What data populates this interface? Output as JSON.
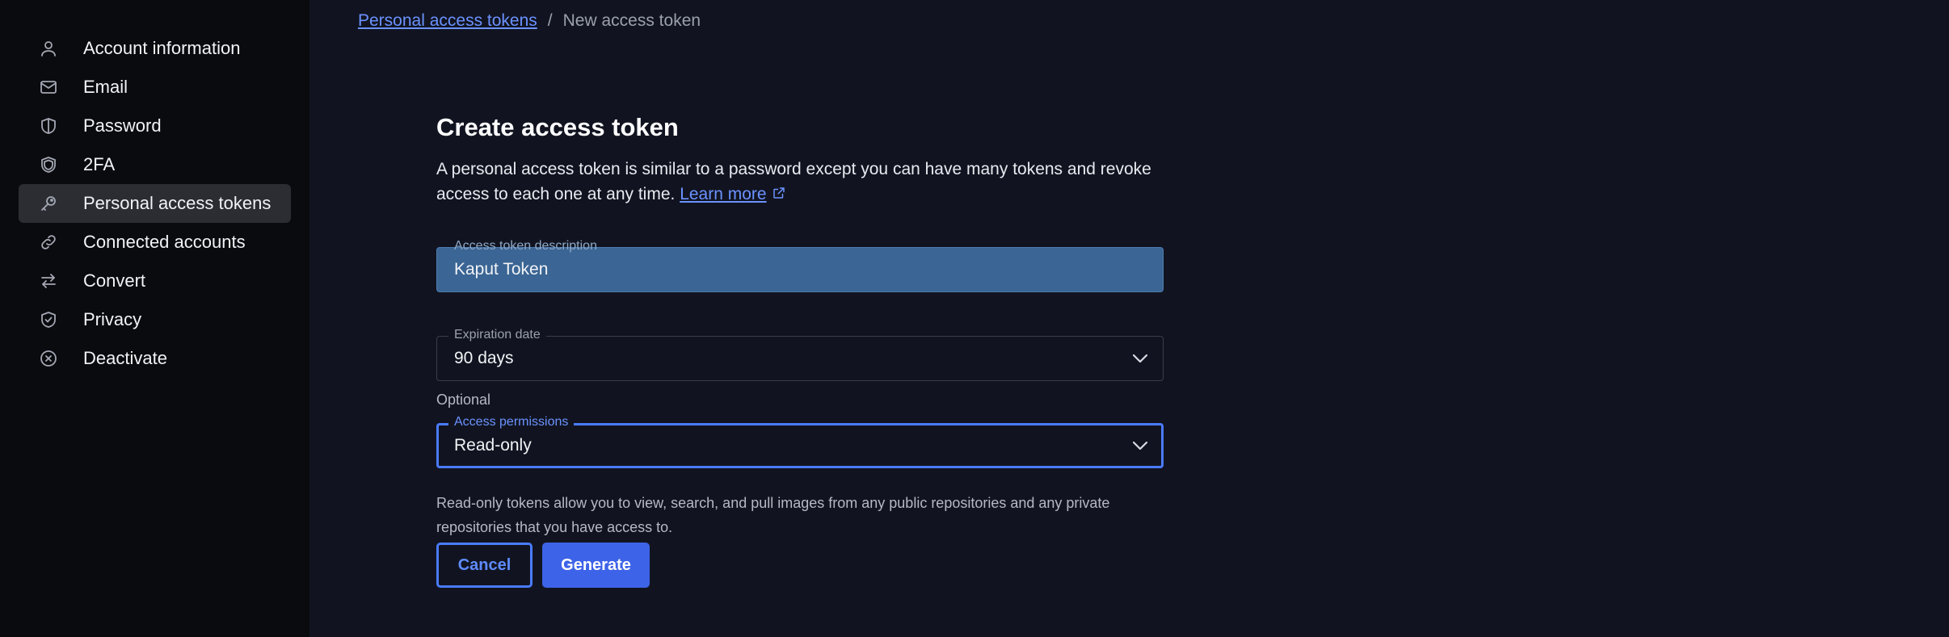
{
  "sidebar": {
    "items": [
      {
        "label": "Account information",
        "icon": "user-icon"
      },
      {
        "label": "Email",
        "icon": "mail-icon"
      },
      {
        "label": "Password",
        "icon": "shield-half-icon"
      },
      {
        "label": "2FA",
        "icon": "shield-double-icon"
      },
      {
        "label": "Personal access tokens",
        "icon": "key-icon",
        "active": true
      },
      {
        "label": "Connected accounts",
        "icon": "link-icon"
      },
      {
        "label": "Convert",
        "icon": "swap-arrows-icon"
      },
      {
        "label": "Privacy",
        "icon": "shield-check-icon"
      },
      {
        "label": "Deactivate",
        "icon": "circle-x-icon"
      }
    ]
  },
  "breadcrumb": {
    "parent": "Personal access tokens",
    "separator": "/",
    "current": "New access token"
  },
  "form": {
    "title": "Create access token",
    "description": "A personal access token is similar to a password except you can have many tokens and revoke access to each one at any time.",
    "learn_more": "Learn more",
    "description_field": {
      "label": "Access token description",
      "value": "Kaput Token"
    },
    "expiration": {
      "label": "Expiration date",
      "value": "90 days"
    },
    "optional_label": "Optional",
    "permissions": {
      "label": "Access permissions",
      "value": "Read-only"
    },
    "help_text": "Read-only tokens allow you to view, search, and pull images from any public repositories and any private repositories that you have access to.",
    "cancel_label": "Cancel",
    "generate_label": "Generate"
  },
  "colors": {
    "accent": "#4a7bff",
    "primary_button": "#3d63e8",
    "background": "#111420",
    "sidebar_background": "#0a0b0e",
    "highlight_field": "#3a6594"
  }
}
